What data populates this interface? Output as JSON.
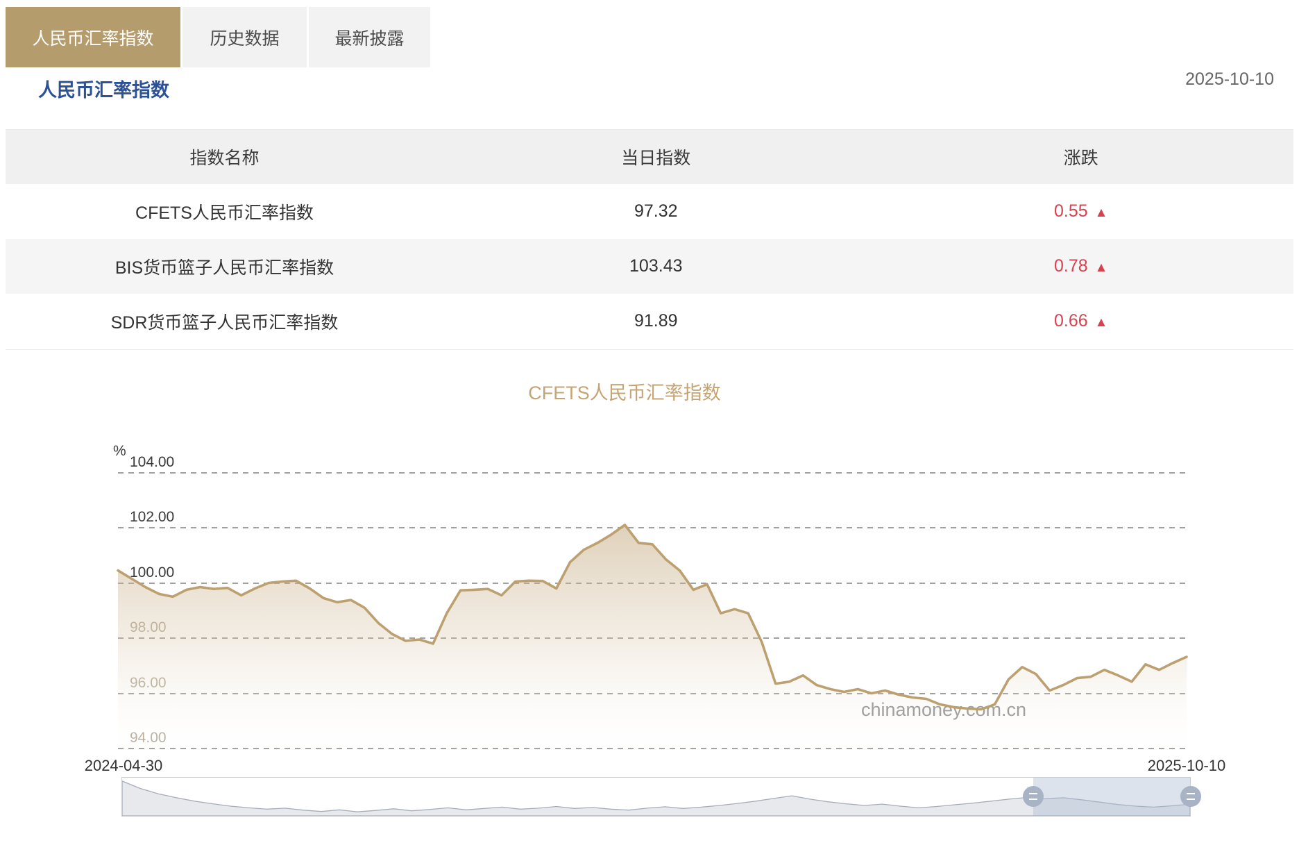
{
  "tabs": {
    "items": [
      {
        "label": "人民币汇率指数",
        "active": true
      },
      {
        "label": "历史数据",
        "active": false
      },
      {
        "label": "最新披露",
        "active": false
      }
    ]
  },
  "header": {
    "title": "人民币汇率指数",
    "date": "2025-10-10"
  },
  "table": {
    "columns": [
      "指数名称",
      "当日指数",
      "涨跌"
    ],
    "rows": [
      {
        "name": "CFETS人民币汇率指数",
        "value": "97.32",
        "change": "0.55",
        "direction": "up"
      },
      {
        "name": "BIS货币篮子人民币汇率指数",
        "value": "103.43",
        "change": "0.78",
        "direction": "up"
      },
      {
        "name": "SDR货币篮子人民币汇率指数",
        "value": "91.89",
        "change": "0.66",
        "direction": "up"
      }
    ],
    "up_arrow": "▲",
    "up_color": "#d8424e"
  },
  "chart": {
    "title": "CFETS人民币汇率指数",
    "unit_label": "%",
    "watermark": "chinamoney.com.cn",
    "x_start_label": "2024-04-30",
    "x_end_label": "2025-10-10",
    "line_color": "#bda06f",
    "title_color": "#c5a473"
  },
  "chart_data": {
    "type": "area",
    "title": "CFETS人民币汇率指数",
    "xlabel": "",
    "ylabel": "%",
    "x_range": [
      "2024-04-30",
      "2025-10-10"
    ],
    "yticks": [
      "104.00",
      "102.00",
      "100.00",
      "98.00",
      "96.00",
      "94.00"
    ],
    "ylim": [
      94,
      104.75
    ],
    "grid": "dashed-horizontal",
    "legend": false,
    "values": [
      100.45,
      100.15,
      99.85,
      99.6,
      99.5,
      99.75,
      99.85,
      99.78,
      99.82,
      99.55,
      99.8,
      100.0,
      100.05,
      100.08,
      99.8,
      99.45,
      99.3,
      99.38,
      99.1,
      98.55,
      98.15,
      97.9,
      97.95,
      97.8,
      98.9,
      99.73,
      99.75,
      99.78,
      99.55,
      100.05,
      100.08,
      100.07,
      99.8,
      100.75,
      101.2,
      101.45,
      101.75,
      102.1,
      101.45,
      101.4,
      100.85,
      100.45,
      99.75,
      99.95,
      98.9,
      99.05,
      98.9,
      97.85,
      96.35,
      96.42,
      96.65,
      96.3,
      96.15,
      96.05,
      96.15,
      96.0,
      96.1,
      95.95,
      95.85,
      95.8,
      95.6,
      95.5,
      95.45,
      95.42,
      95.6,
      96.5,
      96.95,
      96.7,
      96.1,
      96.3,
      96.55,
      96.6,
      96.85,
      96.65,
      96.42,
      97.05,
      96.85,
      97.1,
      97.32
    ],
    "navigator_values": [
      103.0,
      100.8,
      99.2,
      98.0,
      97.0,
      96.2,
      95.5,
      95.0,
      94.6,
      94.9,
      94.3,
      93.9,
      94.4,
      93.8,
      94.2,
      94.7,
      94.1,
      94.5,
      95.0,
      94.4,
      94.8,
      95.2,
      94.6,
      94.9,
      95.4,
      94.8,
      95.1,
      94.6,
      94.3,
      94.9,
      95.3,
      94.8,
      95.2,
      95.7,
      96.3,
      97.0,
      97.8,
      98.6,
      97.6,
      96.8,
      96.2,
      95.7,
      96.1,
      95.5,
      95.0,
      95.4,
      95.9,
      96.4,
      97.0,
      97.6,
      98.1,
      97.7,
      98.0,
      97.4,
      96.7,
      96.0,
      95.5,
      95.2,
      95.6,
      96.1
    ]
  },
  "navigator": {
    "window_start_pct": 85.3,
    "window_end_pct": 100
  }
}
